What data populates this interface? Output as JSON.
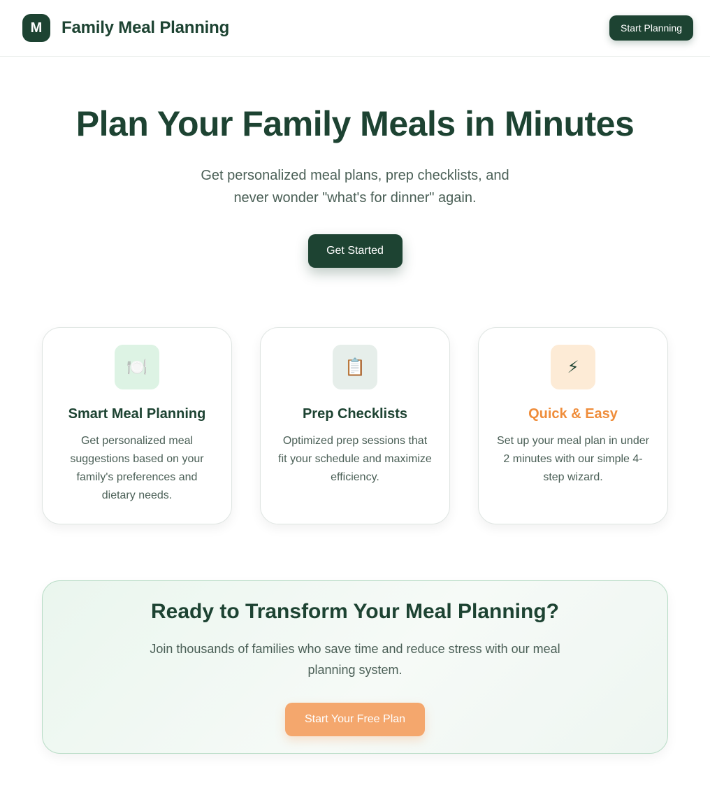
{
  "header": {
    "logo_letter": "M",
    "brand_name": "Family Meal Planning",
    "cta_label": "Start Planning"
  },
  "hero": {
    "title": "Plan Your Family Meals in Minutes",
    "subtitle": "Get personalized meal plans, prep checklists, and never wonder \"what's for dinner\" again.",
    "button_label": "Get Started"
  },
  "features": [
    {
      "icon": "plate-cutlery-icon",
      "icon_glyph": "🍽️",
      "icon_bg": "#ddf3e4",
      "title": "Smart Meal Planning",
      "title_color": "#1d4332",
      "description": "Get personalized meal suggestions based on your family's preferences and dietary needs."
    },
    {
      "icon": "clipboard-icon",
      "icon_glyph": "📋",
      "icon_bg": "#e6eeea",
      "title": "Prep Checklists",
      "title_color": "#1d4332",
      "description": "Optimized prep sessions that fit your schedule and maximize efficiency."
    },
    {
      "icon": "lightning-icon",
      "icon_glyph": "⚡",
      "icon_bg": "#fdebd6",
      "title": "Quick & Easy",
      "title_color": "#ef8d3b",
      "description": "Set up your meal plan in under 2 minutes with our simple 4-step wizard."
    }
  ],
  "cta": {
    "title": "Ready to Transform Your Meal Planning?",
    "description": "Join thousands of families who save time and reduce stress with our meal planning system.",
    "button_label": "Start Your Free Plan"
  },
  "colors": {
    "primary": "#1d4332",
    "accent": "#ef8d3b",
    "cta_button": "#f4a76d",
    "body_text": "#4a5f56"
  }
}
